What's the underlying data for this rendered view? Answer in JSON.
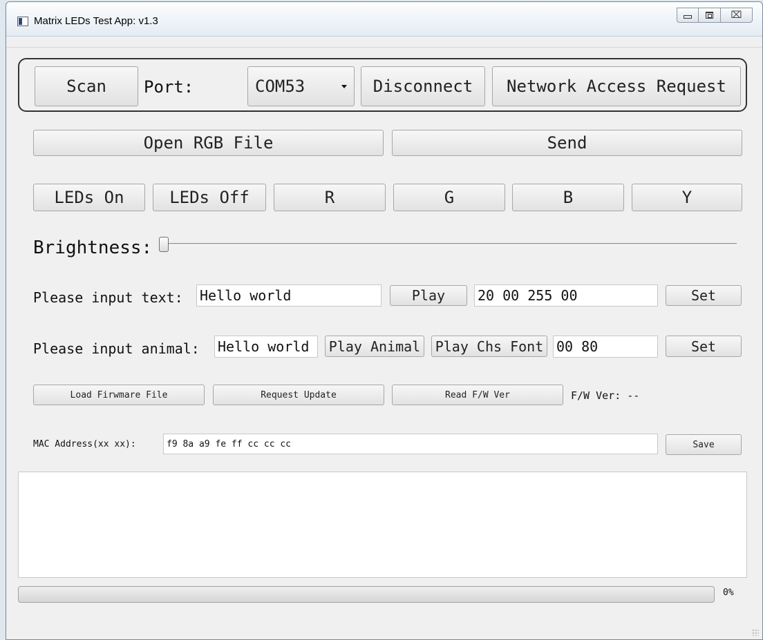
{
  "window": {
    "title": "Matrix LEDs Test App: v1.3",
    "minimize_icon": "minimize-icon",
    "maximize_icon": "maximize-icon",
    "close_icon": "close-icon",
    "close_glyph": "⌧"
  },
  "connection": {
    "scan_label": "Scan",
    "port_label": "Port:",
    "port_value": "COM53",
    "disconnect_label": "Disconnect",
    "network_label": "Network Access Request"
  },
  "file": {
    "open_label": "Open RGB File",
    "send_label": "Send"
  },
  "leds": {
    "on_label": "LEDs On",
    "off_label": "LEDs Off",
    "r_label": "R",
    "g_label": "G",
    "b_label": "B",
    "y_label": "Y"
  },
  "brightness": {
    "label": "Brightness:",
    "level": 0
  },
  "text_row": {
    "label": "Please input text:",
    "text_value": "Hello world",
    "play_label": "Play",
    "param_value": "20 00 255 00",
    "set_label": "Set"
  },
  "animal_row": {
    "label": "Please input animal:",
    "text_value": "Hello world",
    "play_animal_label": "Play Animal",
    "play_chs_label": "Play Chs Font",
    "param_value": "00 80",
    "set_label": "Set"
  },
  "firmware": {
    "load_label": "Load Firwmare File",
    "request_label": "Request Update",
    "read_label": "Read F/W Ver",
    "ver_label": "F/W Ver: --"
  },
  "mac": {
    "label": "MAC Address(xx xx):",
    "value": "f9 8a a9 fe ff cc cc cc",
    "save_label": "Save"
  },
  "log": {
    "text": ""
  },
  "progress": {
    "value_percent": 0,
    "text": "0%"
  },
  "colors": {
    "progress_fill": "#37b24d",
    "window_bg": "#f0f0f0"
  }
}
